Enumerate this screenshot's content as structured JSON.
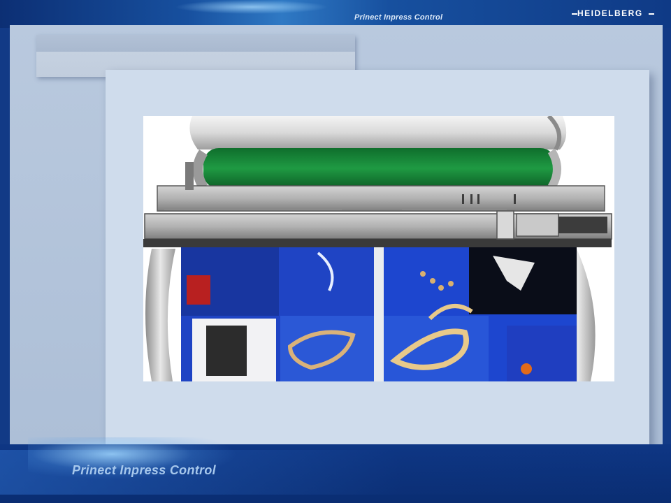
{
  "header": {
    "product_title": "Prinect Inpress Control",
    "logo_text": "HEIDELBERG"
  },
  "footer": {
    "product_title": "Prinect Inpress Control"
  },
  "slide": {
    "title": "",
    "illustration_icon": "printing-press-icon"
  },
  "colors": {
    "frame_blue": "#123a86",
    "stage_gray_blue": "#b9c9de",
    "card_background": "#cfdcec",
    "roller_green": "#1c8a3a",
    "print_blue": "#1f44c4"
  }
}
